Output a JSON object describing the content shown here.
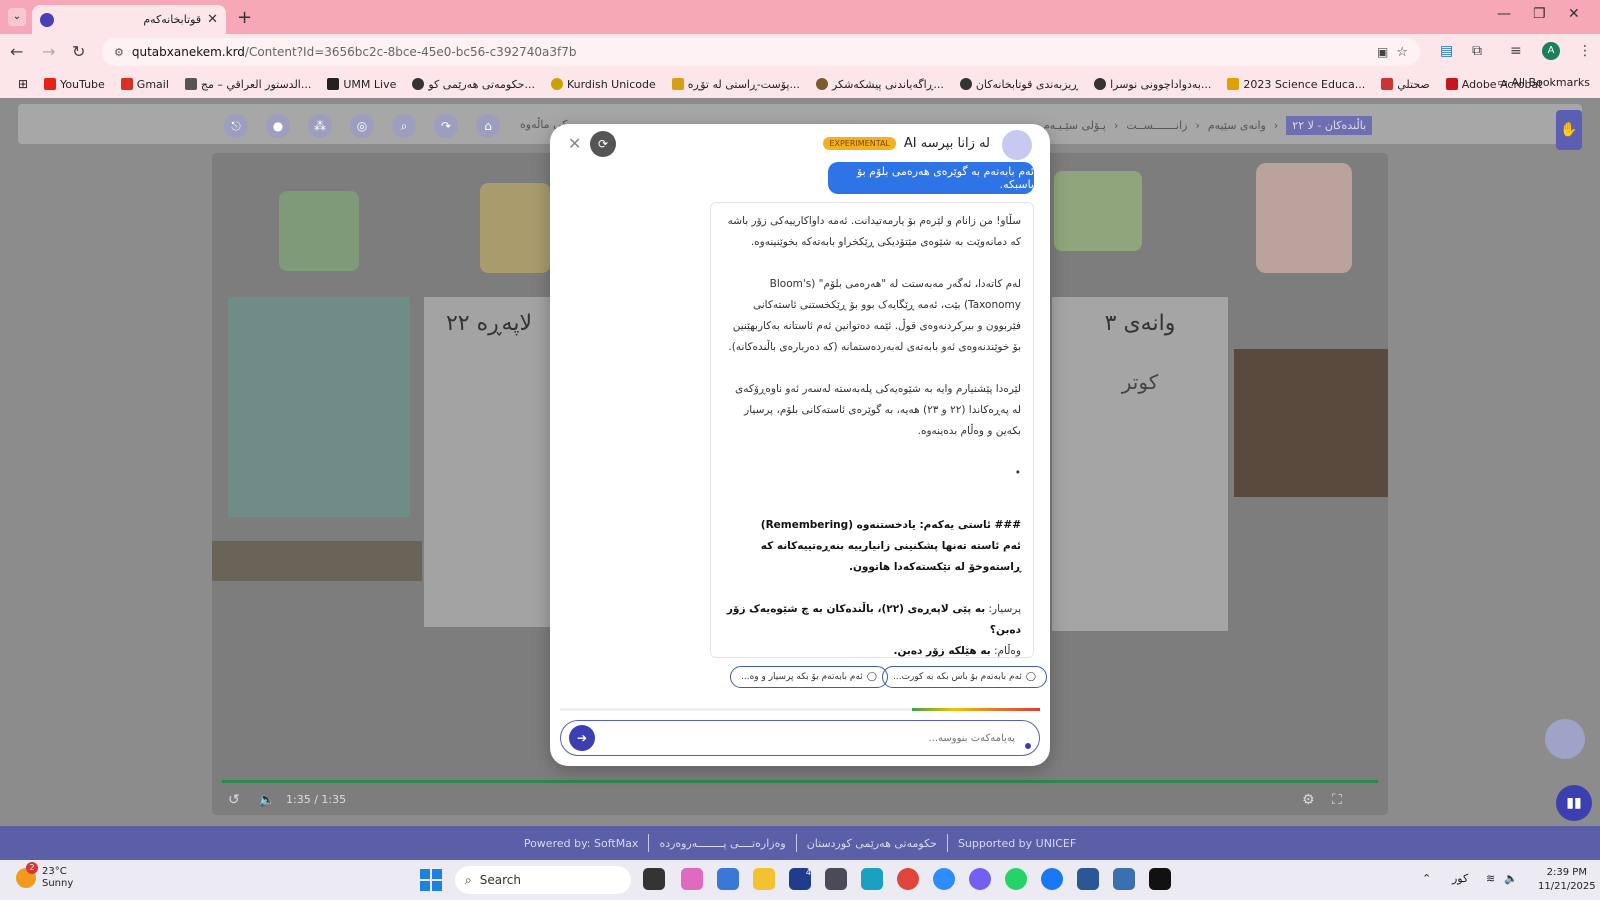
{
  "browser": {
    "tab_title": "قوتابخانەکەم",
    "url_host": "qutabxanekem.krd",
    "url_path": "/Content?Id=3656bc2c-8bce-45e0-bc56-c392740a3f7b",
    "all_bookmarks": "All Bookmarks",
    "bookmarks": [
      {
        "label": "YouTube",
        "color": "#e62117"
      },
      {
        "label": "Gmail",
        "color": "#d93025"
      },
      {
        "label": "الدستور العراقي – مج...",
        "color": "#555555"
      },
      {
        "label": "UMM Live",
        "color": "#222222"
      },
      {
        "label": "حکومەتی هەرێمی کو...",
        "color": "#333333"
      },
      {
        "label": "Kurdish Unicode",
        "color": "#c9a100"
      },
      {
        "label": "پۆست-ڕاستی لە تۆڕە...",
        "color": "#d4a017"
      },
      {
        "label": "ڕاگەیاندنی پیشکەشکر...",
        "color": "#7a5c2e"
      },
      {
        "label": "ڕیزبەندی قوتابخانەکان",
        "color": "#333333"
      },
      {
        "label": "بەدواداچوونی نوسرا...",
        "color": "#333333"
      },
      {
        "label": "2023 Science Educa...",
        "color": "#e0a000"
      },
      {
        "label": "صحتلي",
        "color": "#c33"
      },
      {
        "label": "Adobe Acrobat",
        "color": "#c4161c"
      }
    ]
  },
  "page": {
    "nav_text": "سکی ماڵەوە",
    "breadcrumb": [
      "پـۆلی سێـیـەم",
      "زانـــــــســت",
      "وانەی سێیەم",
      "باڵندەکان - لا ٢٢"
    ],
    "posters": [
      "لاپەڕە ٢٢",
      "وانەی ٣",
      "کوتر"
    ],
    "video_time": "1:35 / 1:35",
    "video_progress": 1.0,
    "footer": [
      "Powered by: SoftMax",
      "وەزارەتــــی پــــــــەروەردە",
      "حکومەتی هەرێمی کوردستان",
      "Supported by UNICEF"
    ]
  },
  "chat": {
    "title": "لە زانا بپرسە AI",
    "badge": "EXPERIMENTAL",
    "user_message": "ئەم بابەتەم بە گوێرەی هەرەمی بلۆم بۆ باسبکە.",
    "answer_paragraphs": [
      "سڵاو! من زانام و لێرەم بۆ یارمەتیدانت. ئەمە داواکارییەکی زۆر باشە کە دمانەوێت بە شێوەی مێتۆدیکی ڕێکخراو بابەتەکە بخوێنینەوە.",
      "لەم کاتەدا، ئەگەر مەبەستت لە \"هەرەمی بلۆم\" (Bloom's Taxonomy) بێت، ئەمە ڕێگایەک بوو بۆ ڕێکخستنی ئاستەکانی فێربوون و بیرکردنەوەی قوڵ. ئێمە دەتوانین ئەم ئاستانە بەکاربهێنین بۆ خوێندنەوەی ئەو بابەتەی لەبەردەستمانە (کە دەربارەی باڵندەکانە).",
      "لێرەدا پێشنیارم وایە بە شێوەیەکی پلەبەستە لەسەر ئەو ناوەڕۆکەی لە پەڕەکاندا (٢٢ و ٢٣) هەیە، بە گوێرەی ئاستەکانی بلۆم، پرسیار بکەین و وەڵام بدەینەوە."
    ],
    "bullet": "•",
    "heading": "### ئاستی یەکەم: یادخستنەوە (Remembering)",
    "heading_desc": "ئەم ئاستە تەنها پشکنینی زانیارییە بنەڕەتییەکانە کە ڕاستەوخۆ لە تێکستەکەدا هاتوون.",
    "q_label": "پرسیار:",
    "q_text": "بە پێی لاپەڕەی (٢٢)، باڵندەکان بە چ شێوەیەک زۆر دەبن؟",
    "a_label": "وەڵام:",
    "a_text": "بە هێلکە زۆر دەبن.",
    "suggestions": [
      "ئەم بابەتەم بۆ باس بکە بە کورت...",
      "ئەم بابەتەم بۆ بکە پرسیار و وە..."
    ],
    "input_placeholder": "پەیامەکەت بنووسە..."
  },
  "taskbar": {
    "badge_count": "2",
    "temperature": "23°C",
    "condition": "Sunny",
    "search_label": "Search",
    "mail_badge": "4",
    "lang": "کور",
    "time": "2:39 PM",
    "date": "11/21/2025"
  },
  "colors": {
    "tabbar": "#f7a8b6",
    "accent": "#3b3fb0",
    "user_bubble": "#2f74e6",
    "badge": "#f5b020",
    "footer": "#5a5fa8"
  }
}
